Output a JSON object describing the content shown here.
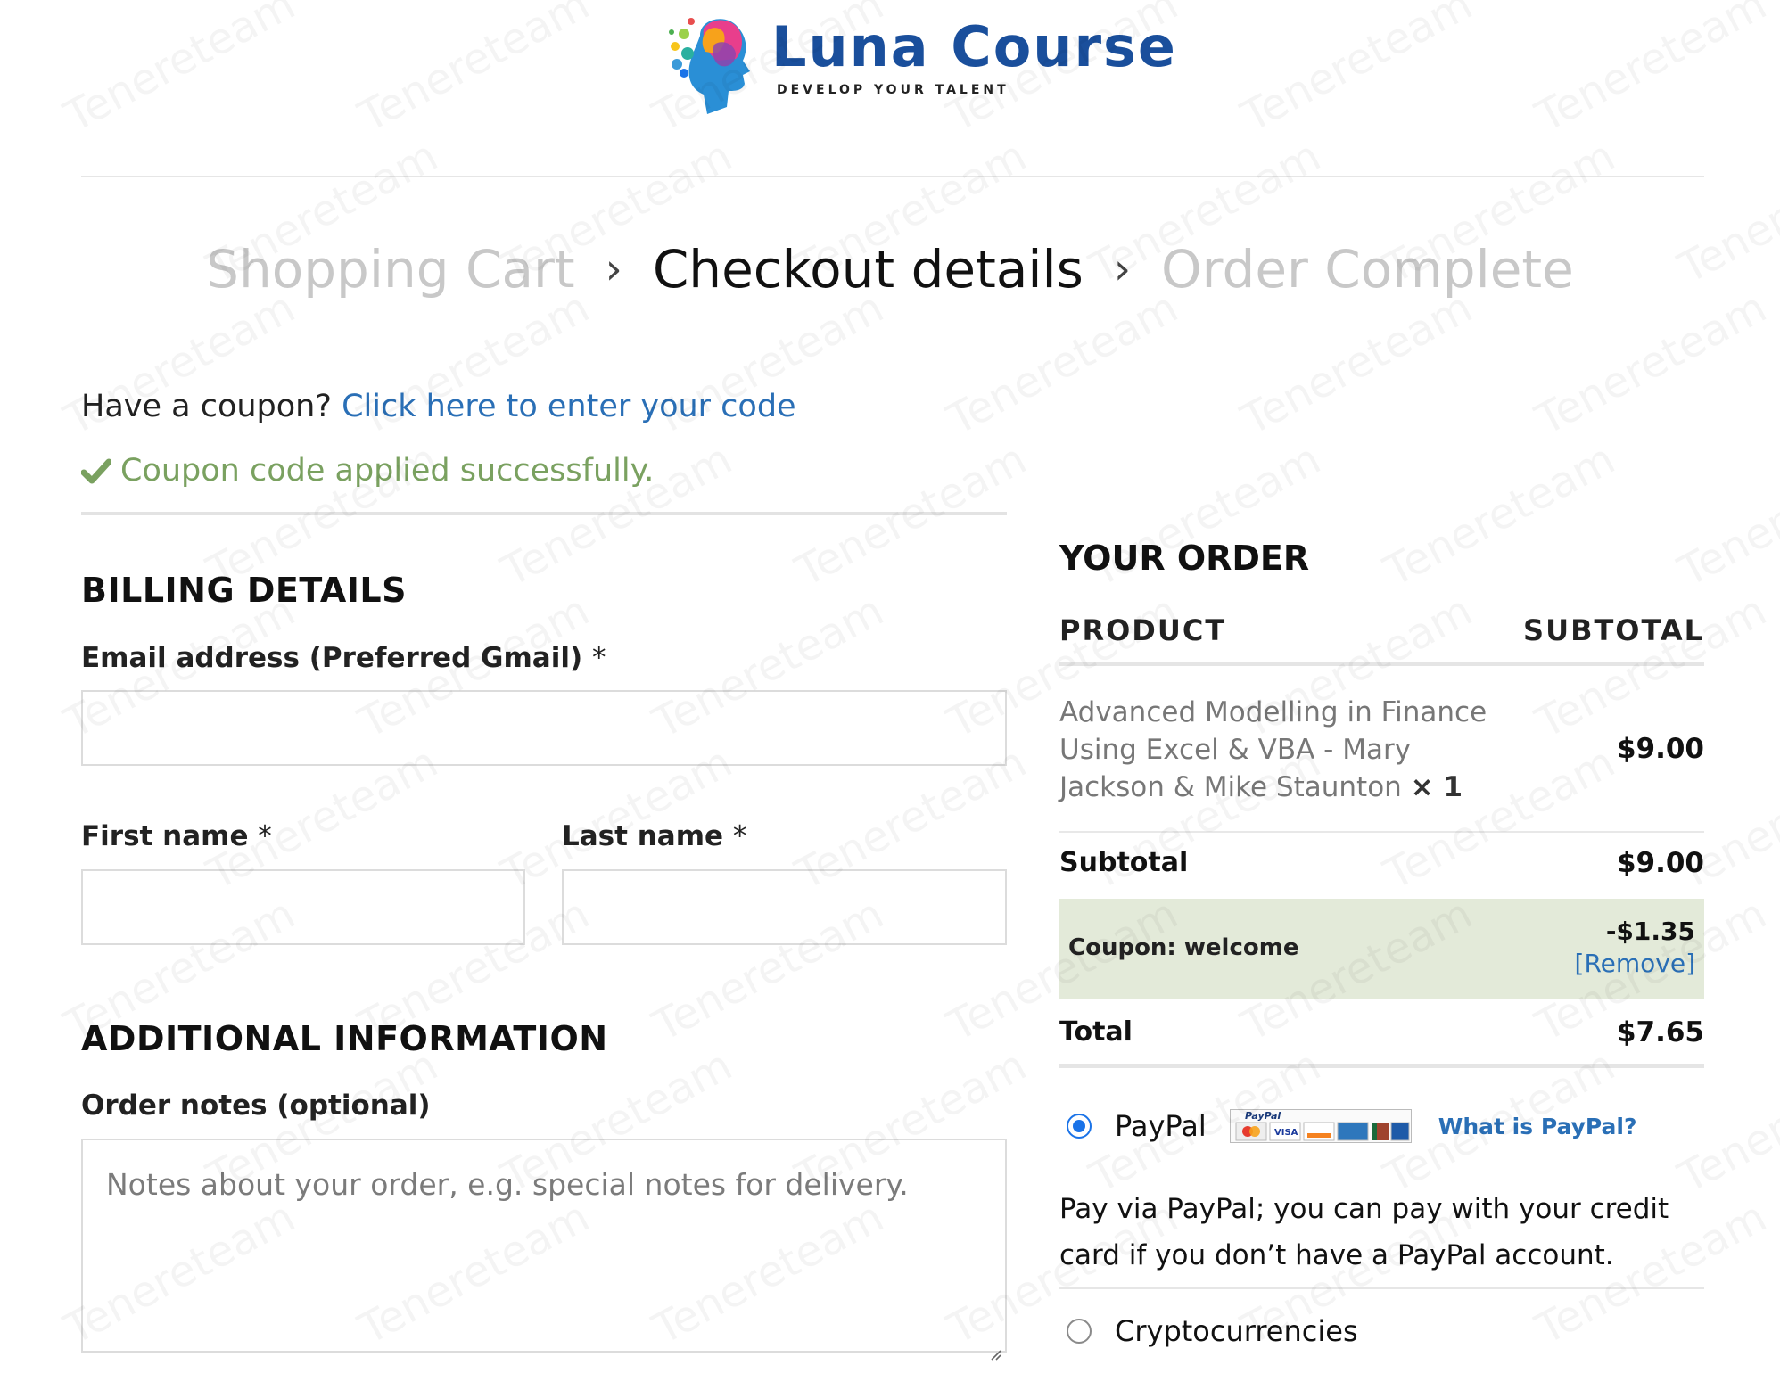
{
  "brand": {
    "name": "Luna Course",
    "tagline": "DEVELOP YOUR TALENT"
  },
  "steps": [
    {
      "label": "Shopping Cart"
    },
    {
      "label": "Checkout details"
    },
    {
      "label": "Order Complete"
    }
  ],
  "coupon": {
    "prompt": "Have a coupon?",
    "link": "Click here to enter your code",
    "success": "Coupon code applied successfully."
  },
  "billing": {
    "heading": "BILLING DETAILS",
    "email_label": "Email address (Preferred Gmail)",
    "first_name_label": "First name",
    "last_name_label": "Last name",
    "required_mark": "*",
    "email_value": "",
    "first_name_value": "",
    "last_name_value": ""
  },
  "additional": {
    "heading": "ADDITIONAL INFORMATION",
    "notes_label": "Order notes (optional)",
    "notes_placeholder": "Notes about your order, e.g. special notes for delivery."
  },
  "order": {
    "heading": "YOUR ORDER",
    "col_product": "PRODUCT",
    "col_subtotal": "SUBTOTAL",
    "item_name": "Advanced Modelling in Finance Using Excel & VBA - Mary Jackson & Mike Staunton",
    "item_qty": "× 1",
    "item_price": "$9.00",
    "subtotal_label": "Subtotal",
    "subtotal_value": "$9.00",
    "coupon_label": "Coupon: welcome",
    "coupon_value": "-$1.35",
    "coupon_remove": "[Remove]",
    "total_label": "Total",
    "total_value": "$7.65"
  },
  "payment": {
    "paypal_label": "PayPal",
    "paypal_badge_text": "PayPal",
    "what_is_paypal": "What is PayPal?",
    "paypal_description": "Pay via PayPal; you can pay with your credit card if you don’t have a PayPal account.",
    "crypto_label": "Cryptocurrencies",
    "selected": "paypal"
  },
  "watermark": "Tenereteam",
  "colors": {
    "brand_blue": "#1a4f9c",
    "link_blue": "#2a6fb6",
    "success_green": "#7aa160",
    "coupon_bg": "#e3ead9",
    "radio_blue": "#1a73e8"
  }
}
